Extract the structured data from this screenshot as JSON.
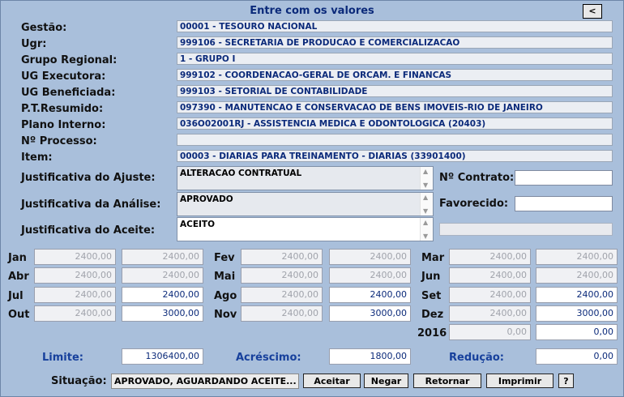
{
  "header": {
    "title": "Entre com os valores",
    "back_label": "<"
  },
  "fields": [
    {
      "label": "Gestão:",
      "value": "00001 - TESOURO NACIONAL"
    },
    {
      "label": "Ugr:",
      "value": "999106 - SECRETARIA DE PRODUCAO E COMERCIALIZACAO"
    },
    {
      "label": "Grupo Regional:",
      "value": "1 - GRUPO I"
    },
    {
      "label": "UG Executora:",
      "value": "999102 - COORDENACAO-GERAL DE ORCAM. E FINANCAS"
    },
    {
      "label": "UG Beneficiada:",
      "value": "999103 - SETORIAL DE CONTABILIDADE"
    },
    {
      "label": "P.T.Resumido:",
      "value": "097390 - MANUTENCAO E CONSERVACAO DE BENS IMOVEIS-RIO DE JANEIRO"
    },
    {
      "label": "Plano Interno:",
      "value": "036O02001RJ - ASSISTENCIA MEDICA E ODONTOLOGICA (20403)"
    },
    {
      "label": "Nº Processo:",
      "value": ""
    },
    {
      "label": "Item:",
      "value": "00003 - DIARIAS PARA TREINAMENTO - DIARIAS (33901400)"
    }
  ],
  "justificativas": [
    {
      "label": "Justificativa do Ajuste:",
      "value": "ALTERACAO CONTRATUAL"
    },
    {
      "label": "Justificativa da Análise:",
      "value": "APROVADO"
    },
    {
      "label": "Justificativa do Aceite:",
      "value": "ACEITO"
    }
  ],
  "contrato": {
    "label": "Nº Contrato:",
    "value": ""
  },
  "favorecido": {
    "label": "Favorecido:",
    "value": ""
  },
  "months": {
    "jan": {
      "label": "Jan",
      "a": "2400,00",
      "b": "2400,00"
    },
    "fev": {
      "label": "Fev",
      "a": "2400,00",
      "b": "2400,00"
    },
    "mar": {
      "label": "Mar",
      "a": "2400,00",
      "b": "2400,00"
    },
    "abr": {
      "label": "Abr",
      "a": "2400,00",
      "b": "2400,00"
    },
    "mai": {
      "label": "Mai",
      "a": "2400,00",
      "b": "2400,00"
    },
    "jun": {
      "label": "Jun",
      "a": "2400,00",
      "b": "2400,00"
    },
    "jul": {
      "label": "Jul",
      "a": "2400,00",
      "b": "2400,00"
    },
    "ago": {
      "label": "Ago",
      "a": "2400,00",
      "b": "2400,00"
    },
    "set": {
      "label": "Set",
      "a": "2400,00",
      "b": "2400,00"
    },
    "out": {
      "label": "Out",
      "a": "2400,00",
      "b": "3000,00"
    },
    "nov": {
      "label": "Nov",
      "a": "2400,00",
      "b": "3000,00"
    },
    "dez": {
      "label": "Dez",
      "a": "2400,00",
      "b": "3000,00"
    },
    "y2016": {
      "label": "2016",
      "a": "0,00",
      "b": "0,00"
    }
  },
  "totals": {
    "limite": {
      "label": "Limite:",
      "value": "1306400,00"
    },
    "acrescimo": {
      "label": "Acréscimo:",
      "value": "1800,00"
    },
    "reducao": {
      "label": "Redução:",
      "value": "0,00"
    }
  },
  "situacao": {
    "label": "Situação:",
    "value": "APROVADO, AGUARDANDO ACEITE..."
  },
  "buttons": {
    "aceitar": "Aceitar",
    "negar": "Negar",
    "retornar": "Retornar",
    "imprimir": "Imprimir",
    "help": "?"
  },
  "colors": {
    "background": "#a9bfdb",
    "field_text": "#0b2a7a",
    "label_blue": "#17409c"
  }
}
